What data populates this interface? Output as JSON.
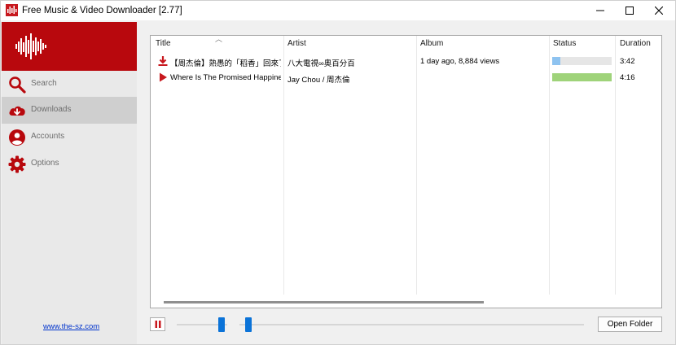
{
  "window": {
    "title": "Free Music & Video Downloader [2.77]"
  },
  "sidebar": {
    "items": [
      {
        "label": "Search",
        "icon": "search-icon"
      },
      {
        "label": "Downloads",
        "icon": "cloud-download-icon",
        "active": true
      },
      {
        "label": "Accounts",
        "icon": "user-icon"
      },
      {
        "label": "Options",
        "icon": "gear-icon"
      }
    ],
    "link_text": "www.the-sz.com"
  },
  "table": {
    "columns": [
      "Title",
      "Artist",
      "Album",
      "Status",
      "Duration"
    ],
    "rows": [
      {
        "icon": "download-arrow-icon",
        "title": "【周杰倫】熱愚的「稻香」回來了！時...",
        "artist": "八大電視∞奧百分百",
        "album": "1 day ago, 8,884 views",
        "progress": 0.14,
        "duration": "3:42"
      },
      {
        "icon": "play-icon",
        "title": "Where Is The Promised Happine...",
        "artist": "Jay Chou / 周杰倫",
        "album": "",
        "progress": 1.0,
        "duration": "4:16"
      }
    ]
  },
  "player": {
    "open_folder_label": "Open Folder"
  },
  "colors": {
    "brand_red": "#b8080d",
    "progress_partial": "#8ec3f0",
    "progress_done": "#9fd37a",
    "slider_thumb": "#0b73d8"
  }
}
